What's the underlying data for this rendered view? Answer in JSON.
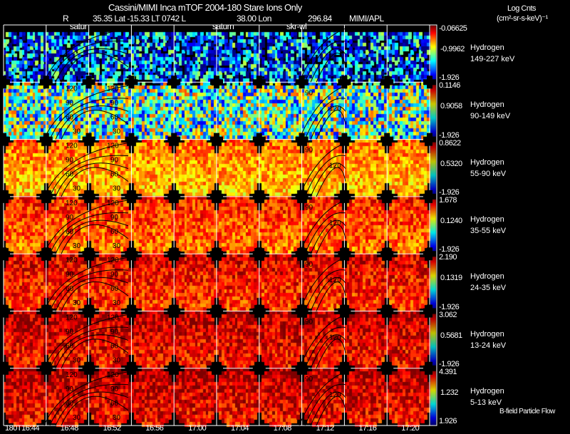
{
  "header": {
    "title": "Cassini/MIMI Inca mTOF  2004-180   Stare   Ions Only",
    "line2": {
      "r": "R",
      "pos": "35.35 Lat -15.33 LT 0742 L",
      "lon": "38.00 Lon",
      "val": "296.84",
      "credit": "MIMI/APL"
    },
    "units": "Log Cnts",
    "units2": "(cm²-sr-s-keV)⁻¹",
    "annotations": [
      "satur",
      "saturn",
      "skr-wl"
    ]
  },
  "footer": {
    "legend": "B-field Particle Flow"
  },
  "chart_data": {
    "type": "heatmap",
    "time_ticks": [
      "180T16:44",
      "16:48",
      "16:52",
      "16:56",
      "17:00",
      "17:04",
      "17:08",
      "17:12",
      "17:16",
      "17:20"
    ],
    "colormap": "jet",
    "contour_labels": [
      "120",
      "90",
      "60",
      "30"
    ],
    "panels": [
      {
        "species": "Hydrogen",
        "energy": "149-227 keV",
        "cmax": "-0.06625",
        "cmid": "-0.9962",
        "cmin": "-1.926",
        "level": 0.22
      },
      {
        "species": "Hydrogen",
        "energy": "90-149 keV",
        "cmax": "0.1146",
        "cmid": "0.9058",
        "cmin": "-1.926",
        "level": 0.45
      },
      {
        "species": "Hydrogen",
        "energy": "55-90 keV",
        "cmax": "0.8622",
        "cmid": "0.5320",
        "cmin": "-1.926",
        "level": 0.72
      },
      {
        "species": "Hydrogen",
        "energy": "35-55 keV",
        "cmax": "1.678",
        "cmid": "0.1240",
        "cmin": "-1.926",
        "level": 0.8
      },
      {
        "species": "Hydrogen",
        "energy": "24-35 keV",
        "cmax": "2.190",
        "cmid": "0.1319",
        "cmin": "-1.926",
        "level": 0.86
      },
      {
        "species": "Hydrogen",
        "energy": "13-24 keV",
        "cmax": "3.062",
        "cmid": "0.5681",
        "cmin": "-1.926",
        "level": 0.9
      },
      {
        "species": "Hydrogen",
        "energy": "5-13 keV",
        "cmax": "4.391",
        "cmid": "1.232",
        "cmin": "1.926",
        "level": 0.91
      }
    ]
  }
}
